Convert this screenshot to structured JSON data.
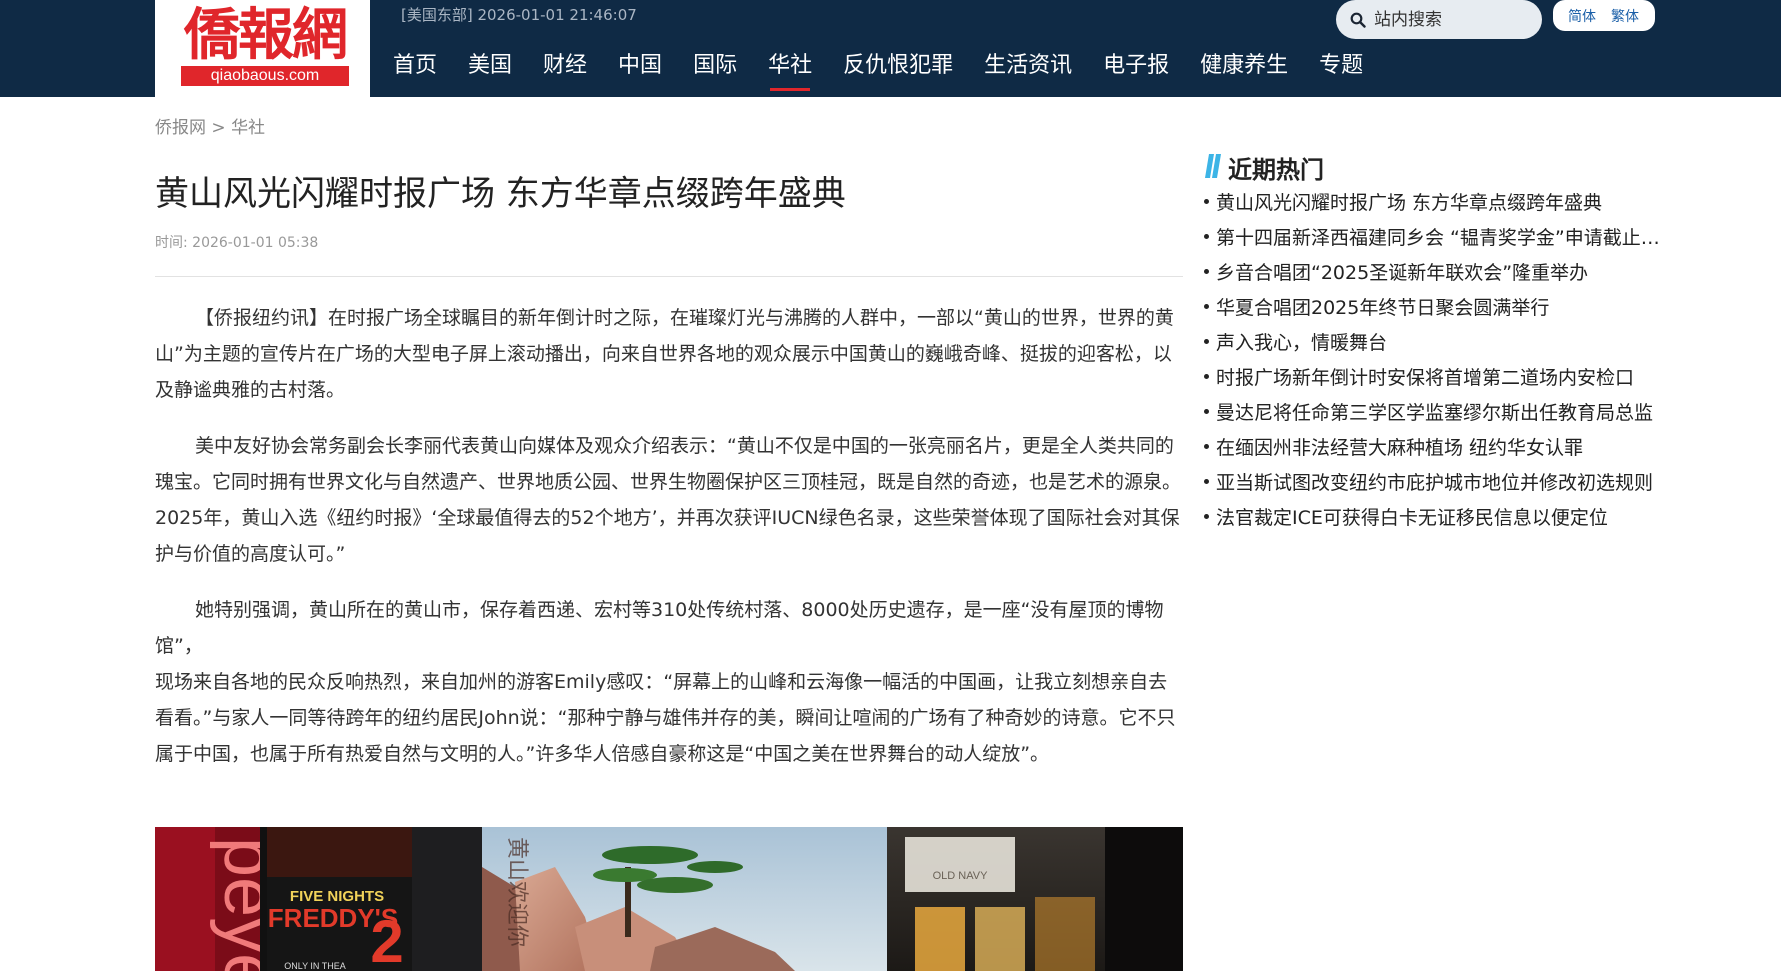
{
  "header": {
    "logo_text": "僑報網",
    "logo_url": "qiaobaous.com",
    "dateline": "[美国东部] 2026-01-01 21:46:07",
    "nav": [
      {
        "label": "首页"
      },
      {
        "label": "美国"
      },
      {
        "label": "财经"
      },
      {
        "label": "中国"
      },
      {
        "label": "国际"
      },
      {
        "label": "华社",
        "active": true
      },
      {
        "label": "反仇恨犯罪"
      },
      {
        "label": "生活资讯"
      },
      {
        "label": "电子报"
      },
      {
        "label": "健康养生"
      },
      {
        "label": "专题"
      }
    ],
    "search_placeholder": "站内搜索",
    "lang_simplified": "简体",
    "lang_traditional": "繁体"
  },
  "breadcrumb": {
    "home": "侨报网",
    "separator": ">",
    "section": "华社"
  },
  "article": {
    "title": "黄山风光闪耀时报广场 东方华章点缀跨年盛典",
    "time": "时间: 2026-01-01 05:38",
    "paragraphs": [
      "【侨报纽约讯】在时报广场全球瞩目的新年倒计时之际，在璀璨灯光与沸腾的人群中，一部以“黄山的世界，世界的黄山”为主题的宣传片在广场的大型电子屏上滚动播出，向来自世界各地的观众展示中国黄山的巍峨奇峰、挺拔的迎客松，以及静谧典雅的古村落。",
      "美中友好协会常务副会长李丽代表黄山向媒体及观众介绍表示：“黄山不仅是中国的一张亮丽名片，更是全人类共同的瑰宝。它同时拥有世界文化与自然遗产、世界地质公园、世界生物圈保护区三顶桂冠，既是自然的奇迹，也是艺术的源泉。2025年，黄山入选《纽约时报》‘全球最值得去的52个地方’，并再次获评IUCN绿色名录，这些荣誉体现了国际社会对其保护与价值的高度认可。”",
      "她特别强调，黄山所在的黄山市，保存着西递、宏村等310处传统村落、8000处历史遗存，是一座“没有屋顶的博物馆”，",
      "现场来自各地的民众反响热烈，来自加州的游客Emily感叹：“屏幕上的山峰和云海像一幅活的中国画，让我立刻想亲自去看看。”与家人一同等待跨年的纽约居民John说：“那种宁静与雄伟并存的美，瞬间让喧闹的广场有了种奇妙的诗意。它不只属于中国，也属于所有热爱自然与文明的人。”许多华人倍感自豪称这是“中国之美在世界舞台的动人绽放”。"
    ],
    "photo_signs": {
      "brand_vertical": "peye",
      "movie_line1": "FIVE NIGHTS",
      "movie_line2": "FREDDY'S",
      "movie_number": "2",
      "movie_bottom": "ONLY IN THEA",
      "calligraphy": "黄山欢迎你",
      "building_sign": "OLD NAVY"
    }
  },
  "sidebar": {
    "heading": "近期热门",
    "items": [
      "黄山风光闪耀时报广场 东方华章点缀跨年盛典",
      "第十四届新泽西福建同乡会 “韫青奖学金”申请截止日期",
      "乡音合唱团“2025圣诞新年联欢会”隆重举办",
      "华夏合唱团2025年终节日聚会圆满举行",
      "声入我心，情暖舞台",
      "时报广场新年倒计时安保将首增第二道场内安检口",
      "曼达尼将任命第三学区学监塞缪尔斯出任教育局总监",
      "在缅因州非法经营大麻种植场 纽约华女认罪",
      "亚当斯试图改变纽约市庇护城市地位并修改初选规则",
      "法官裁定ICE可获得白卡无证移民信息以便定位"
    ]
  },
  "colors": {
    "header_bg": "#0f2a45",
    "accent_red": "#e0262b",
    "hot_bar_blue": "#3cb4e6"
  }
}
